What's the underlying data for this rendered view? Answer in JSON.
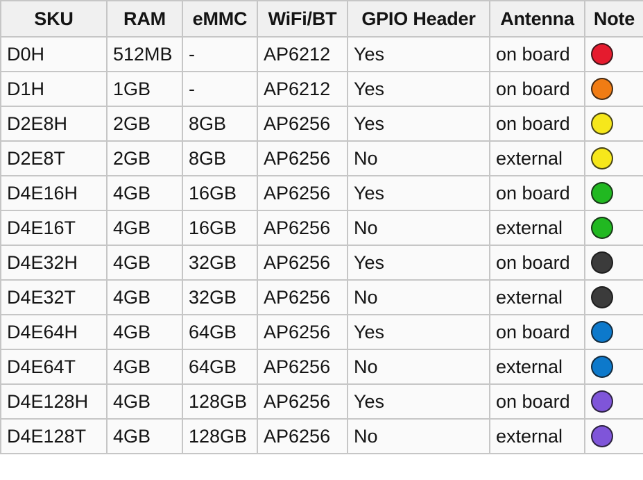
{
  "table": {
    "columns": [
      {
        "key": "sku",
        "label": "SKU"
      },
      {
        "key": "ram",
        "label": "RAM"
      },
      {
        "key": "emmc",
        "label": "eMMC"
      },
      {
        "key": "wifi_bt",
        "label": "WiFi/BT"
      },
      {
        "key": "gpio",
        "label": "GPIO Header"
      },
      {
        "key": "antenna",
        "label": "Antenna"
      },
      {
        "key": "note",
        "label": "Note"
      }
    ],
    "rows": [
      {
        "sku": "D0H",
        "ram": "512MB",
        "emmc": "-",
        "wifi_bt": "AP6212",
        "gpio": "Yes",
        "antenna": "on board",
        "note_color": "#e51b2e",
        "note_name": "red-dot"
      },
      {
        "sku": "D1H",
        "ram": "1GB",
        "emmc": "-",
        "wifi_bt": "AP6212",
        "gpio": "Yes",
        "antenna": "on board",
        "note_color": "#f07c14",
        "note_name": "orange-dot"
      },
      {
        "sku": "D2E8H",
        "ram": "2GB",
        "emmc": "8GB",
        "wifi_bt": "AP6256",
        "gpio": "Yes",
        "antenna": "on board",
        "note_color": "#f6e71b",
        "note_name": "yellow-dot"
      },
      {
        "sku": "D2E8T",
        "ram": "2GB",
        "emmc": "8GB",
        "wifi_bt": "AP6256",
        "gpio": "No",
        "antenna": "external",
        "note_color": "#f6e71b",
        "note_name": "yellow-dot"
      },
      {
        "sku": "D4E16H",
        "ram": "4GB",
        "emmc": "16GB",
        "wifi_bt": "AP6256",
        "gpio": "Yes",
        "antenna": "on board",
        "note_color": "#21b821",
        "note_name": "green-dot"
      },
      {
        "sku": "D4E16T",
        "ram": "4GB",
        "emmc": "16GB",
        "wifi_bt": "AP6256",
        "gpio": "No",
        "antenna": "external",
        "note_color": "#21b821",
        "note_name": "green-dot"
      },
      {
        "sku": "D4E32H",
        "ram": "4GB",
        "emmc": "32GB",
        "wifi_bt": "AP6256",
        "gpio": "Yes",
        "antenna": "on board",
        "note_color": "#3b3b3b",
        "note_name": "dark-gray-dot"
      },
      {
        "sku": "D4E32T",
        "ram": "4GB",
        "emmc": "32GB",
        "wifi_bt": "AP6256",
        "gpio": "No",
        "antenna": "external",
        "note_color": "#3b3b3b",
        "note_name": "dark-gray-dot"
      },
      {
        "sku": "D4E64H",
        "ram": "4GB",
        "emmc": "64GB",
        "wifi_bt": "AP6256",
        "gpio": "Yes",
        "antenna": "on board",
        "note_color": "#0d79cb",
        "note_name": "blue-dot"
      },
      {
        "sku": "D4E64T",
        "ram": "4GB",
        "emmc": "64GB",
        "wifi_bt": "AP6256",
        "gpio": "No",
        "antenna": "external",
        "note_color": "#0d79cb",
        "note_name": "blue-dot"
      },
      {
        "sku": "D4E128H",
        "ram": "4GB",
        "emmc": "128GB",
        "wifi_bt": "AP6256",
        "gpio": "Yes",
        "antenna": "on board",
        "note_color": "#7f55d9",
        "note_name": "purple-dot"
      },
      {
        "sku": "D4E128T",
        "ram": "4GB",
        "emmc": "128GB",
        "wifi_bt": "AP6256",
        "gpio": "No",
        "antenna": "external",
        "note_color": "#7f55d9",
        "note_name": "purple-dot"
      }
    ]
  },
  "style": {
    "header_background": "#f0f0f0",
    "cell_background": "#fafafa",
    "border_color": "#c6c6c6",
    "text_color": "#141414"
  }
}
